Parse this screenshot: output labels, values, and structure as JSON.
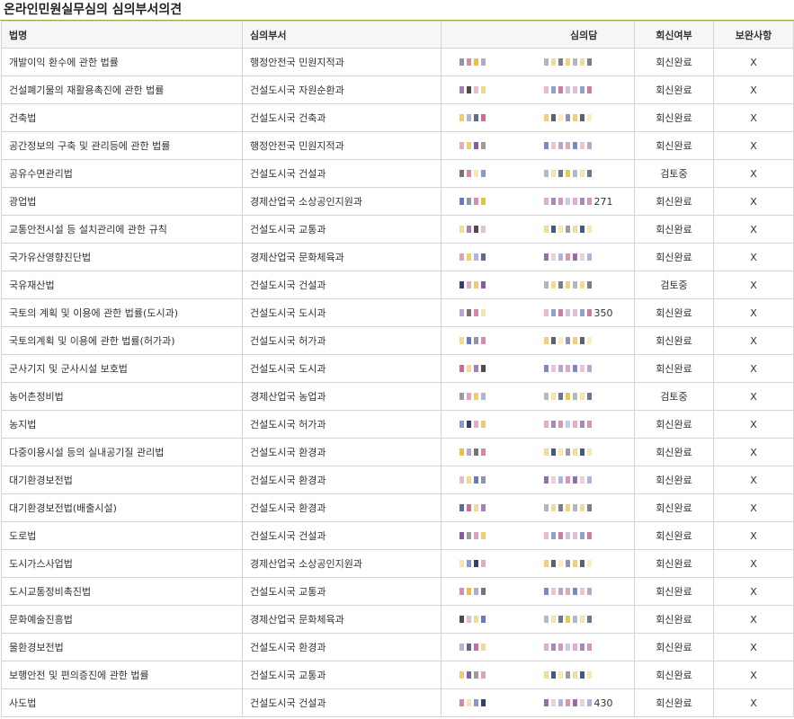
{
  "page": {
    "title": "온라인민원실무심의 심의부서의견"
  },
  "table": {
    "headers": {
      "law": "법명",
      "dept": "심의부서",
      "person": "심의담",
      "reply": "회신여부",
      "supplement": "보완사항"
    },
    "rows": [
      {
        "law": "개발이익 환수에 관한 법률",
        "dept": "행정안전국 민원지적과",
        "phone_tail": "",
        "reply": "회신완료",
        "supplement": "X"
      },
      {
        "law": "건설폐기물의 재활용촉진에 관한 법률",
        "dept": "건설도시국 자원순환과",
        "phone_tail": "",
        "reply": "회신완료",
        "supplement": "X"
      },
      {
        "law": "건축법",
        "dept": "건설도시국 건축과",
        "phone_tail": "",
        "reply": "회신완료",
        "supplement": "X"
      },
      {
        "law": "공간정보의 구축 및 관리등에 관한 법률",
        "dept": "행정안전국 민원지적과",
        "phone_tail": "",
        "reply": "회신완료",
        "supplement": "X"
      },
      {
        "law": "공유수면관리법",
        "dept": "건설도시국 건설과",
        "phone_tail": "",
        "reply": "검토중",
        "supplement": "X"
      },
      {
        "law": "광업법",
        "dept": "경제산업국 소상공인지원과",
        "phone_tail": "271",
        "reply": "회신완료",
        "supplement": "X"
      },
      {
        "law": "교통안전시설 등 설치관리에 관한 규칙",
        "dept": "건설도시국 교통과",
        "phone_tail": "",
        "reply": "회신완료",
        "supplement": "X"
      },
      {
        "law": "국가유산영향진단법",
        "dept": "경제산업국 문화체육과",
        "phone_tail": "",
        "reply": "회신완료",
        "supplement": "X"
      },
      {
        "law": "국유재산법",
        "dept": "건설도시국 건설과",
        "phone_tail": "",
        "reply": "검토중",
        "supplement": "X"
      },
      {
        "law": "국토의 계획 및 이용에 관한 법률(도시과)",
        "dept": "건설도시국 도시과",
        "phone_tail": "350",
        "reply": "회신완료",
        "supplement": "X"
      },
      {
        "law": "국토의계획 및 이용에 관한 법률(허가과)",
        "dept": "건설도시국 허가과",
        "phone_tail": "",
        "reply": "회신완료",
        "supplement": "X"
      },
      {
        "law": "군사기지 및 군사시설 보호법",
        "dept": "건설도시국 도시과",
        "phone_tail": "",
        "reply": "회신완료",
        "supplement": "X"
      },
      {
        "law": "농어촌정비법",
        "dept": "경제산업국 농업과",
        "phone_tail": "",
        "reply": "검토중",
        "supplement": "X"
      },
      {
        "law": "농지법",
        "dept": "건설도시국 허가과",
        "phone_tail": "",
        "reply": "회신완료",
        "supplement": "X"
      },
      {
        "law": "다중이용시설 등의 실내공기질 관리법",
        "dept": "건설도시국 환경과",
        "phone_tail": "",
        "reply": "회신완료",
        "supplement": "X"
      },
      {
        "law": "대기환경보전법",
        "dept": "건설도시국 환경과",
        "phone_tail": "",
        "reply": "회신완료",
        "supplement": "X"
      },
      {
        "law": "대기환경보전법(배출시설)",
        "dept": "건설도시국 환경과",
        "phone_tail": "",
        "reply": "회신완료",
        "supplement": "X"
      },
      {
        "law": "도로법",
        "dept": "건설도시국 건설과",
        "phone_tail": "",
        "reply": "회신완료",
        "supplement": "X"
      },
      {
        "law": "도시가스사업법",
        "dept": "경제산업국 소상공인지원과",
        "phone_tail": "",
        "reply": "회신완료",
        "supplement": "X"
      },
      {
        "law": "도시교통정비촉진법",
        "dept": "건설도시국 교통과",
        "phone_tail": "",
        "reply": "회신완료",
        "supplement": "X"
      },
      {
        "law": "문화예술진흥법",
        "dept": "경제산업국 문화체육과",
        "phone_tail": "",
        "reply": "회신완료",
        "supplement": "X"
      },
      {
        "law": "물환경보전법",
        "dept": "건설도시국 환경과",
        "phone_tail": "",
        "reply": "회신완료",
        "supplement": "X"
      },
      {
        "law": "보행안전 및 편의증진에 관한 법률",
        "dept": "건설도시국 교통과",
        "phone_tail": "",
        "reply": "회신완료",
        "supplement": "X"
      },
      {
        "law": "사도법",
        "dept": "건설도시국 건설과",
        "phone_tail": "430",
        "reply": "회신완료",
        "supplement": "X"
      }
    ]
  },
  "mask_colors": [
    "#1f2a5c",
    "#c85a8a",
    "#e8b830",
    "#7a4a9a",
    "#3a3a3a",
    "#d07aa0",
    "#f0c860",
    "#5a6abf"
  ]
}
